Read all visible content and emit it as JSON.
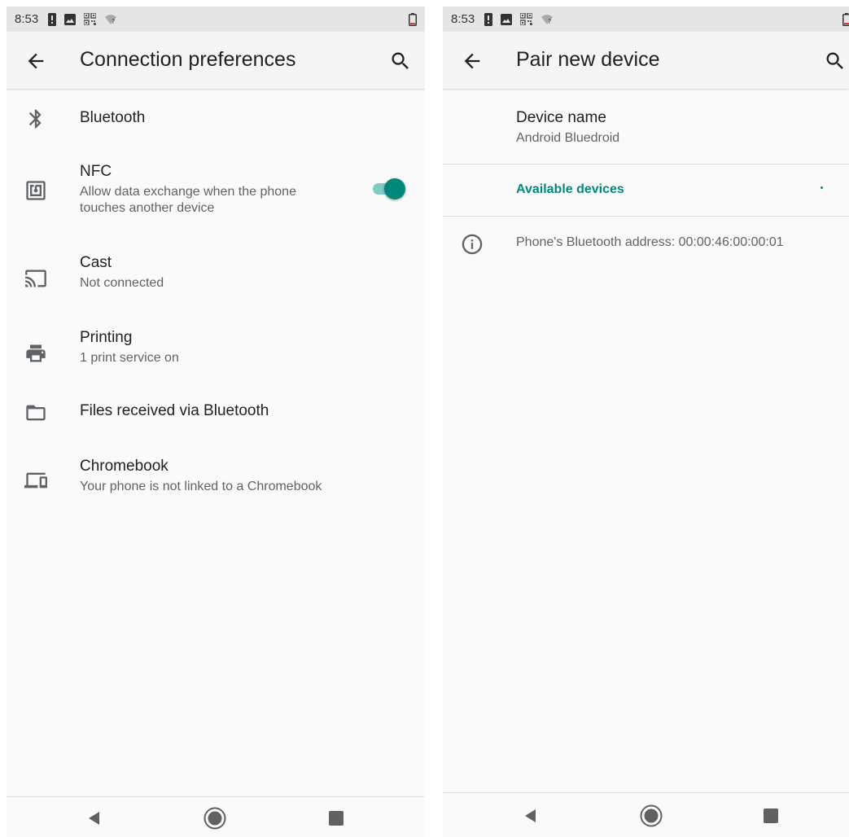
{
  "status_bar": {
    "time": "8:53",
    "icons": [
      "sim-alert-icon",
      "image-icon",
      "qr-code-icon",
      "wifi-question-icon"
    ],
    "battery_icon": "battery-icon"
  },
  "left": {
    "appbar": {
      "title": "Connection preferences",
      "back_icon": "arrow-back-icon",
      "search_icon": "search-icon"
    },
    "items": [
      {
        "icon": "bluetooth-icon",
        "title": "Bluetooth",
        "summary": ""
      },
      {
        "icon": "nfc-icon",
        "title": "NFC",
        "summary_line1": "Allow data exchange when the phone",
        "summary_line2": "touches another device",
        "toggle_on": true
      },
      {
        "icon": "cast-icon",
        "title": "Cast",
        "summary": "Not connected"
      },
      {
        "icon": "printer-icon",
        "title": "Printing",
        "summary": "1 print service on"
      },
      {
        "icon": "folder-icon",
        "title": "Files received via Bluetooth",
        "summary": ""
      },
      {
        "icon": "devices-icon",
        "title": "Chromebook",
        "summary": "Your phone is not linked to a Chromebook"
      }
    ]
  },
  "right": {
    "appbar": {
      "title": "Pair new device",
      "back_icon": "arrow-back-icon",
      "search_icon": "search-icon"
    },
    "device_name": {
      "title": "Device name",
      "value": "Android Bluedroid"
    },
    "available_devices_header": "Available devices",
    "info": {
      "icon": "info-icon",
      "text": "Phone's Bluetooth address: 00:00:46:00:00:01"
    }
  },
  "navigation_bar": {
    "back_icon": "nav-back-icon",
    "home_icon": "nav-home-icon",
    "recents_icon": "nav-recents-icon"
  },
  "colors": {
    "accent": "#00897b",
    "accent_track": "#80cbc4",
    "text_primary": "#202124",
    "text_secondary": "#5f6368",
    "background": "#fafafa"
  }
}
